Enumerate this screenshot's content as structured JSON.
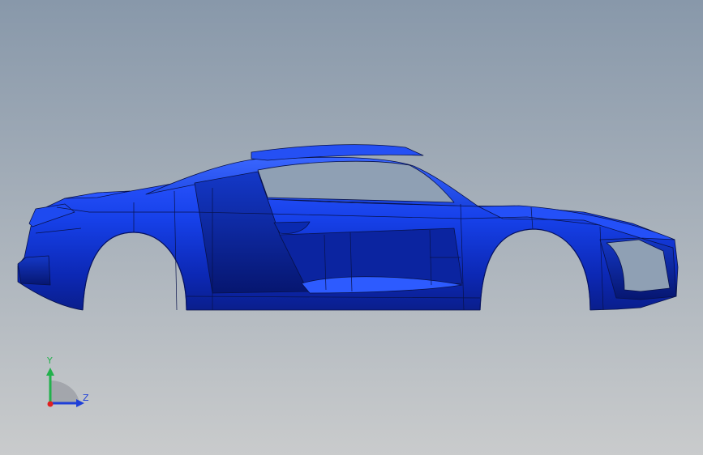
{
  "viewport": {
    "background_top": "#8898AA",
    "background_bottom": "#C9CBCC",
    "model_color": "#1438D8",
    "model_shadow": "#0A1E92",
    "edge_color": "#08124A"
  },
  "model": {
    "name": "car-body-side-view",
    "icon": "car-body-model"
  },
  "triad": {
    "y_label": "Y",
    "z_label": "Z",
    "y_color": "#22B14C",
    "z_color": "#1E3FD8",
    "x_color": "#E02020"
  }
}
